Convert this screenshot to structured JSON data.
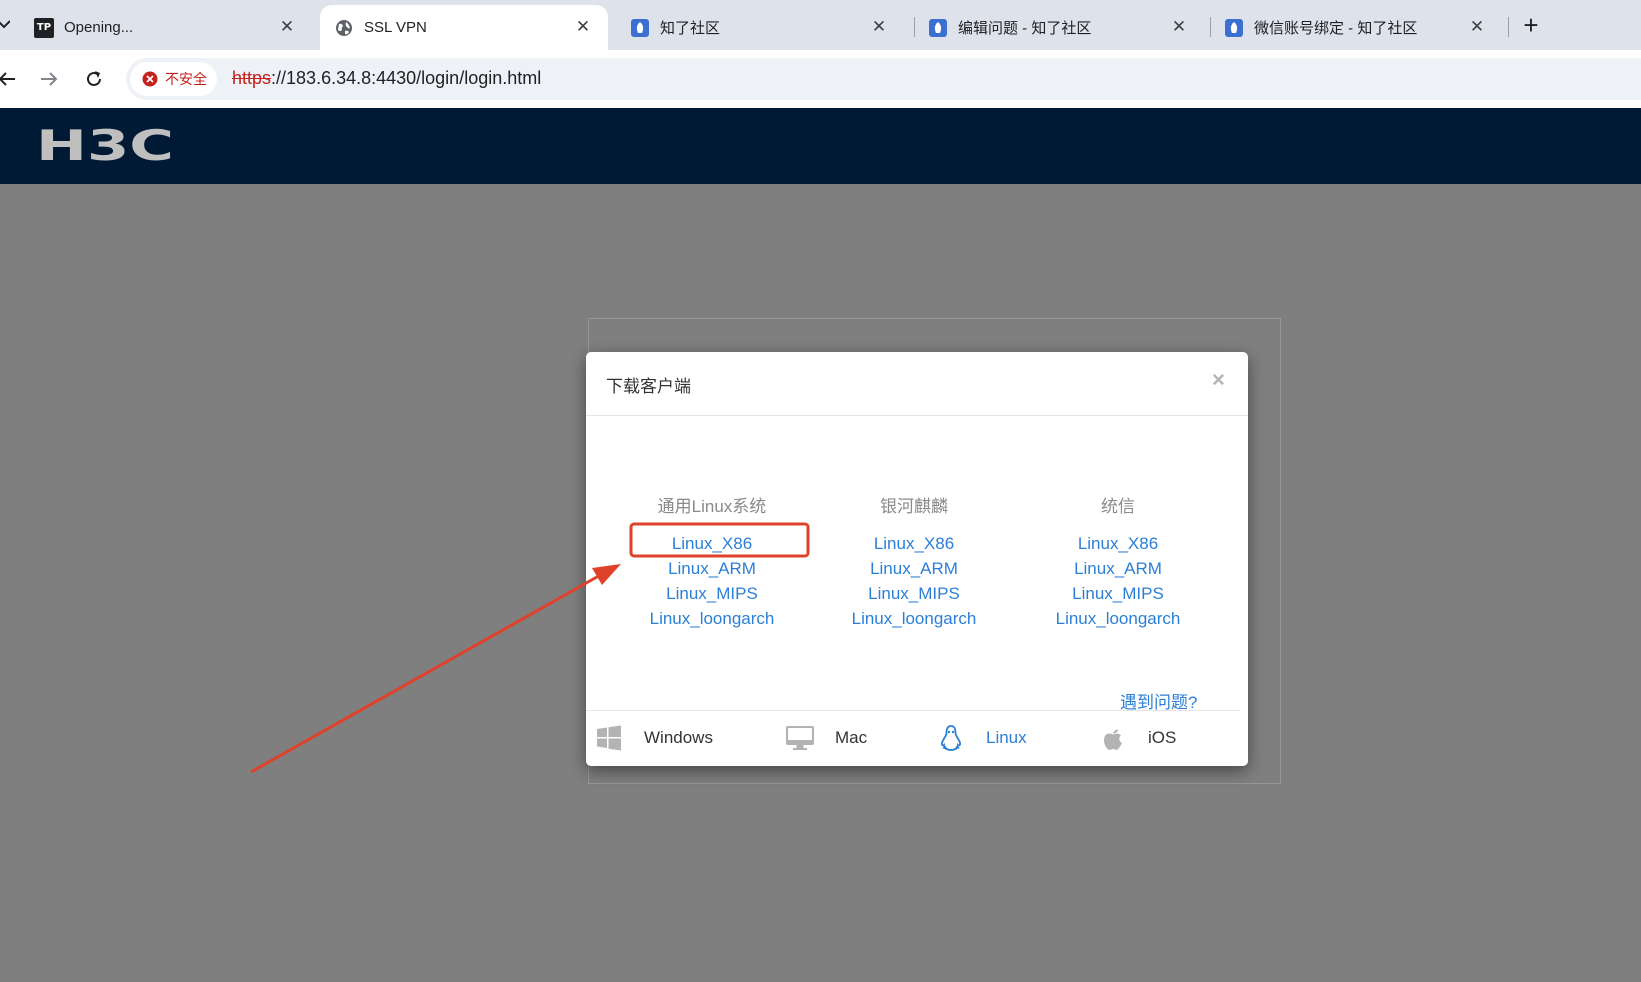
{
  "browser": {
    "tabs": [
      {
        "title": "Opening...",
        "icon": "tp-icon"
      },
      {
        "title": "SSL VPN",
        "icon": "globe-icon"
      },
      {
        "title": "知了社区",
        "icon": "zhiliao-icon"
      },
      {
        "title": "编辑问题 - 知了社区",
        "icon": "zhiliao-icon"
      },
      {
        "title": "微信账号绑定 - 知了社区",
        "icon": "zhiliao-icon"
      }
    ],
    "active_tab": 1,
    "security_label": "不安全",
    "url_scheme": "https",
    "url_rest": "://183.6.34.8:4430/login/login.html"
  },
  "page": {
    "logo_text": "H3C",
    "header_color": "#001a35",
    "background_color": "#7f7f7f"
  },
  "modal": {
    "title": "下载客户端",
    "close_symbol": "×",
    "columns": [
      {
        "heading": "通用Linux系统",
        "links": [
          "Linux_X86",
          "Linux_ARM",
          "Linux_MIPS",
          "Linux_loongarch"
        ]
      },
      {
        "heading": "银河麒麟",
        "links": [
          "Linux_X86",
          "Linux_ARM",
          "Linux_MIPS",
          "Linux_loongarch"
        ]
      },
      {
        "heading": "统信",
        "links": [
          "Linux_X86",
          "Linux_ARM",
          "Linux_MIPS",
          "Linux_loongarch"
        ]
      }
    ],
    "help_link": "遇到问题?",
    "os_tabs": [
      {
        "label": "Windows",
        "icon": "windows-icon"
      },
      {
        "label": "Mac",
        "icon": "monitor-icon"
      },
      {
        "label": "Linux",
        "icon": "tux-icon"
      },
      {
        "label": "iOS",
        "icon": "apple-icon"
      }
    ],
    "active_os_tab": "Linux",
    "link_color": "#2b7fd6"
  },
  "annotation": {
    "highlight_color": "#e0412b"
  }
}
